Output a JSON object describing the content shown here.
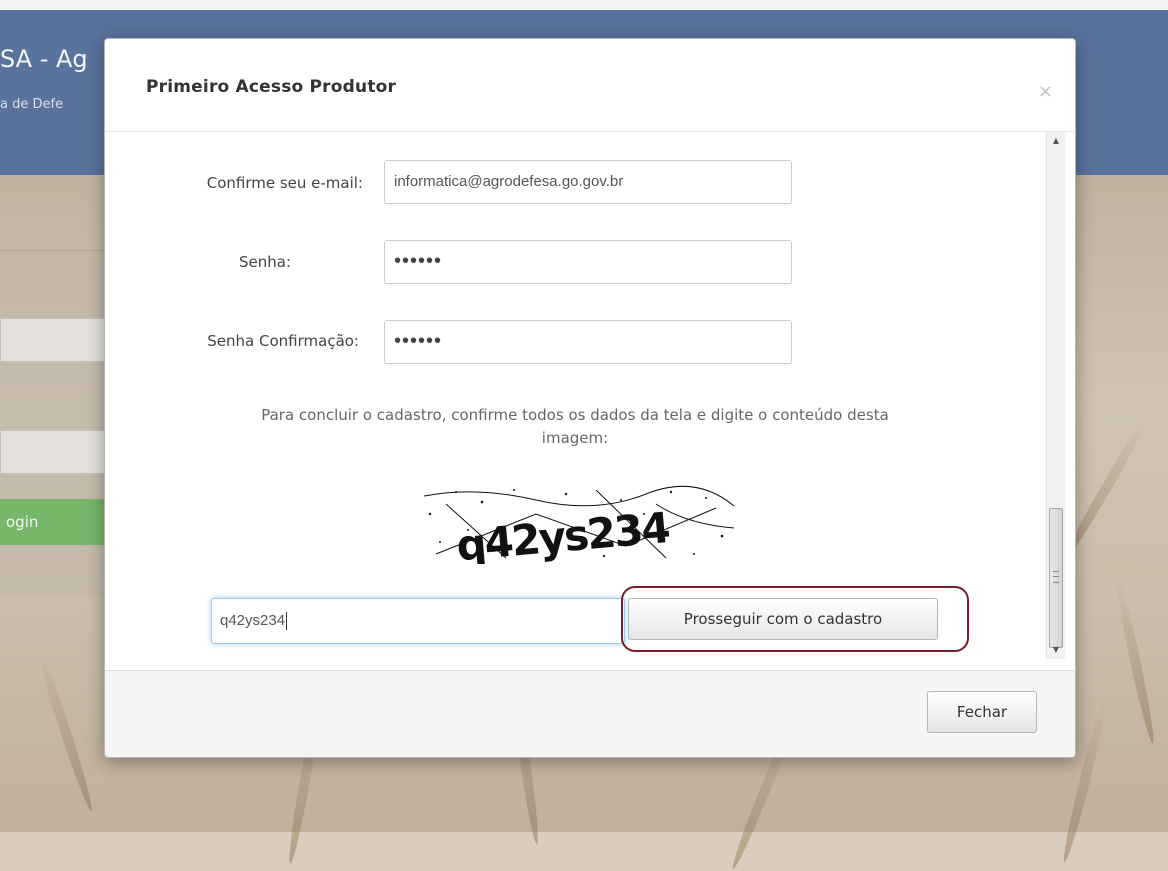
{
  "background": {
    "brand_title": "SA - Ag",
    "brand_subtitle": "a de Defe",
    "login_button": "ogin"
  },
  "modal": {
    "title": "Primeiro Acesso Produtor",
    "close_glyph": "×",
    "form": {
      "email_label": "Confirme seu e-mail:",
      "email_value": "informatica@agrodefesa.go.gov.br",
      "password_label": "Senha:",
      "password_value": "••••••",
      "password_confirm_label": "Senha Confirmação:",
      "password_confirm_value": "••••••",
      "instruction_line1": "Para concluir o cadastro, confirme todos os dados da tela e digite o conteúdo desta",
      "instruction_line2": "imagem:",
      "captcha_text": "q42ys234",
      "captcha_input_value": "q42ys234",
      "continue_button": "Prosseguir com o cadastro"
    },
    "footer": {
      "close_button": "Fechar"
    }
  },
  "colors": {
    "header_blue": "#5e78a4",
    "login_green": "#7cbf6f",
    "highlight_ring": "#7b1e2b"
  },
  "icons": {
    "close": "close-icon",
    "scroll_up": "scroll-up-arrow-icon",
    "scroll_down": "scroll-down-arrow-icon"
  }
}
